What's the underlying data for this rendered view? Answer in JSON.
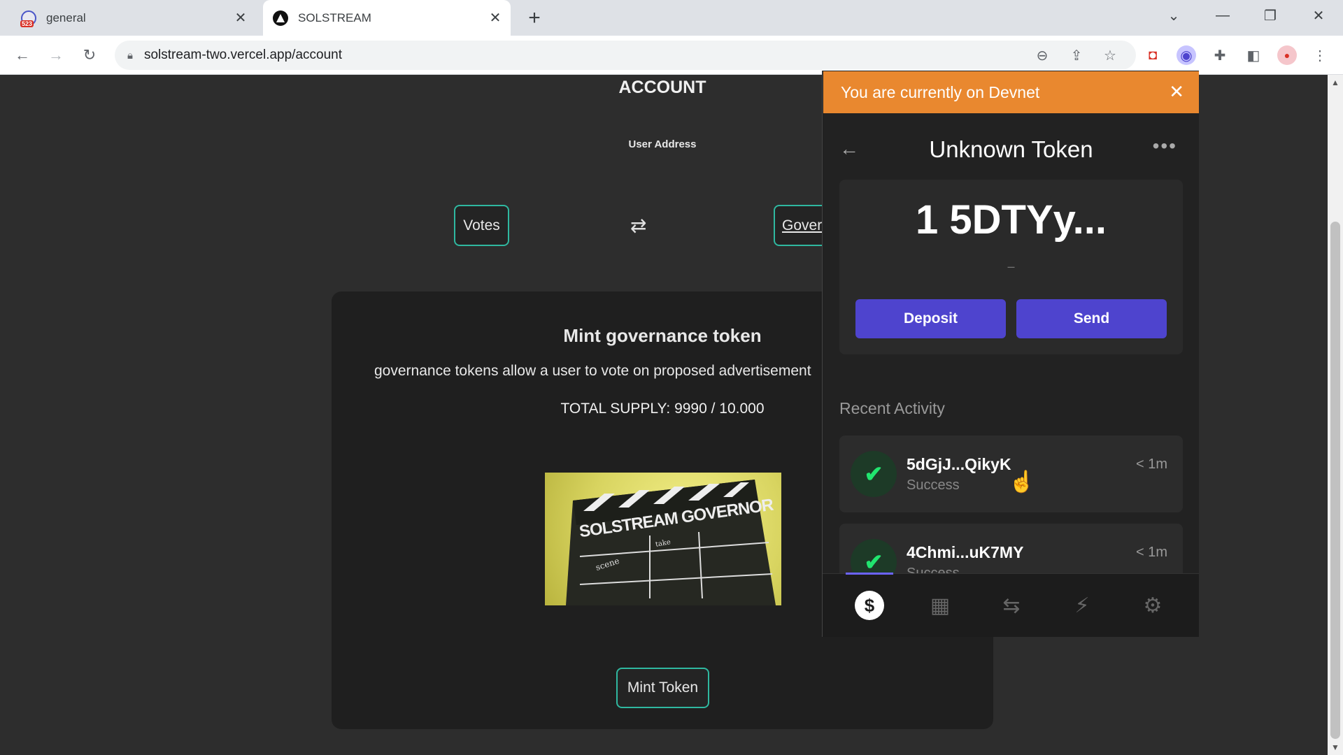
{
  "browser": {
    "tabs": [
      {
        "title": "general",
        "close": "✕",
        "favicon_badge": "523"
      },
      {
        "title": "SOLSTREAM",
        "close": "✕"
      }
    ],
    "new_tab": "+",
    "url": "solstream-two.vercel.app/account",
    "window_controls": [
      "⌄",
      "—",
      "❐",
      "✕"
    ]
  },
  "page": {
    "title": "ACCOUNT",
    "user_address_label": "User Address",
    "votes_button": "Votes",
    "swap_icon": "⇄",
    "governance_button": "Gover",
    "card": {
      "title": "Mint governance token",
      "description": "governance tokens allow a user to vote on proposed advertisement",
      "supply": "TOTAL SUPPLY: 9990 / 10.000",
      "image_text": "SOLSTREAM GOVERNOR",
      "image_scene": "scene",
      "image_take": "take",
      "mint_button": "Mint Token"
    }
  },
  "wallet": {
    "banner": "You are currently on Devnet",
    "banner_close": "✕",
    "header_title": "Unknown Token",
    "back": "←",
    "more": "•••",
    "balance": "1 5DTYy...",
    "balance_sub": "–",
    "deposit_label": "Deposit",
    "send_label": "Send",
    "recent_activity_label": "Recent Activity",
    "activities": [
      {
        "id": "5dGjJ...QikyK",
        "status": "Success",
        "time": "< 1m"
      },
      {
        "id": "4Chmi...uK7MY",
        "status": "Success",
        "time": "< 1m"
      }
    ],
    "footer_icons": [
      "dollar-icon",
      "grid-icon",
      "swap-icon",
      "bolt-icon",
      "gear-icon"
    ],
    "accent_color": "#4e44ce",
    "banner_color": "#e9882f"
  }
}
